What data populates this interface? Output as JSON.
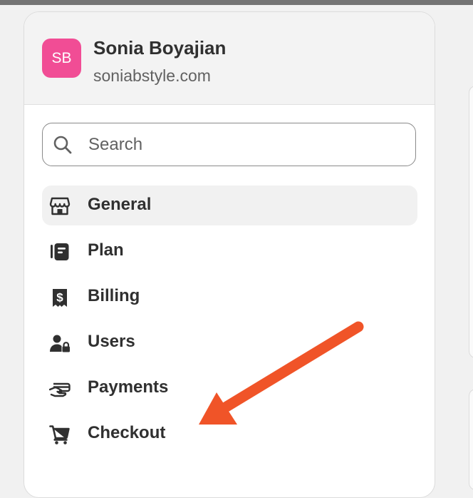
{
  "store": {
    "initials": "SB",
    "name": "Sonia Boyajian",
    "domain": "soniabstyle.com",
    "avatar_color": "#f14d95"
  },
  "search": {
    "placeholder": "Search",
    "value": ""
  },
  "nav": {
    "items": [
      {
        "label": "General",
        "icon": "store-icon",
        "active": true
      },
      {
        "label": "Plan",
        "icon": "plan-icon",
        "active": false
      },
      {
        "label": "Billing",
        "icon": "billing-receipt-icon",
        "active": false
      },
      {
        "label": "Users",
        "icon": "users-lock-icon",
        "active": false
      },
      {
        "label": "Payments",
        "icon": "payments-hand-card-icon",
        "active": false
      },
      {
        "label": "Checkout",
        "icon": "cart-icon",
        "active": false
      }
    ]
  },
  "annotation": {
    "arrow_color": "#f05428",
    "points_to": "Checkout"
  }
}
